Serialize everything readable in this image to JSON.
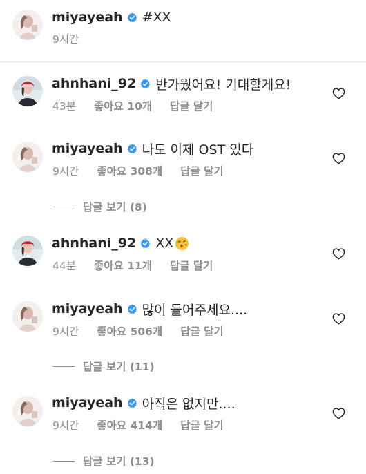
{
  "caption": {
    "username": "miyayeah",
    "text": "#XX",
    "time": "9시간"
  },
  "icons": {
    "verified": "verified-badge-icon",
    "like": "heart-outline-icon",
    "emoji": "kissing-face-emoji"
  },
  "colors": {
    "verified_blue": "#3897f0",
    "meta_gray": "#8e8e8e",
    "text_dark": "#262626"
  },
  "comments": [
    {
      "username": "ahnhani_92",
      "text": "반가웠어요! 기대할게요!",
      "time": "43분",
      "likes": "좋아요 10개",
      "reply": "답글 달기"
    },
    {
      "username": "miyayeah",
      "text": "나도 이제 OST 있다",
      "time": "9시간",
      "likes": "좋아요 308개",
      "reply": "답글 달기",
      "view_replies": "답글 보기 (8)"
    },
    {
      "username": "ahnhani_92",
      "text": "XX",
      "time": "44분",
      "likes": "좋아요 11개",
      "reply": "답글 달기"
    },
    {
      "username": "miyayeah",
      "text": "많이 들어주세요....",
      "time": "9시간",
      "likes": "좋아요 506개",
      "reply": "답글 달기",
      "view_replies": "답글 보기 (11)"
    },
    {
      "username": "miyayeah",
      "text": "아직은 없지만....",
      "time": "9시간",
      "likes": "좋아요 414개",
      "reply": "답글 달기",
      "view_replies": "답글 보기 (13)"
    }
  ]
}
